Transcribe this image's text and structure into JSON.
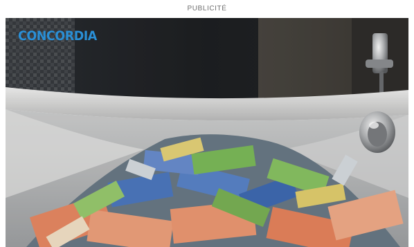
{
  "ad": {
    "label": "PUBLICITÉ",
    "brand": "CONCORDIA"
  },
  "colors": {
    "label_text": "#6f6f6f",
    "brand": "#2a8fd6",
    "background": "#ffffff"
  },
  "icons": {
    "faucet": "chrome-faucet-icon",
    "drain": "overflow-drain-icon"
  }
}
